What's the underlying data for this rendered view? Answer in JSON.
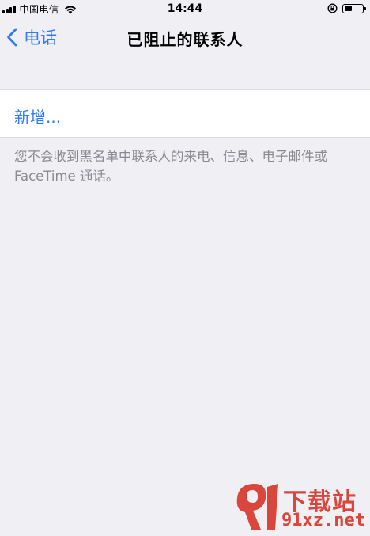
{
  "status_bar": {
    "carrier": "中国电信",
    "time": "14:44",
    "battery_level": 0.45,
    "icons": [
      "signal-icon",
      "wifi-icon",
      "rotation-lock-icon",
      "battery-icon"
    ]
  },
  "nav": {
    "back_label": "电话",
    "title": "已阻止的联系人"
  },
  "list": {
    "add_new_label": "新增..."
  },
  "footer": {
    "note": "您不会收到黑名单中联系人的来电、信息、电子邮件或 FaceTime 通话。"
  },
  "watermark": {
    "title": "下载站",
    "url": "91xz.net"
  },
  "colors": {
    "accent": "#2f7bf6",
    "background": "#efeff4",
    "secondary_text": "#8a8a8f",
    "watermark": "#d8463c"
  }
}
